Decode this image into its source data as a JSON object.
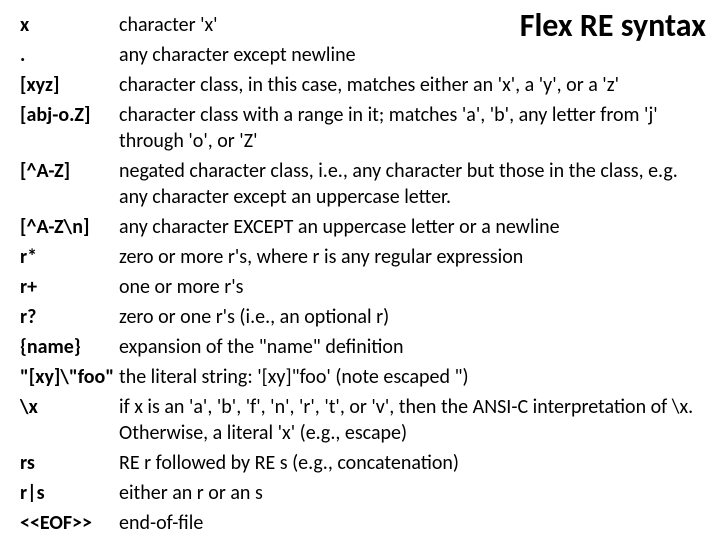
{
  "title": "Flex RE syntax",
  "rows": [
    {
      "pattern": "x",
      "desc": "character 'x'"
    },
    {
      "pattern": ".",
      "desc": "any character except newline"
    },
    {
      "pattern": "[xyz]",
      "desc": "character class, in this case, matches either an 'x', a 'y', or a 'z'"
    },
    {
      "pattern": "[abj-o.Z]",
      "desc": "character class with a range in it; matches 'a', 'b', any letter from 'j' through 'o', or 'Z'"
    },
    {
      "pattern": "[^A-Z]",
      "desc": "negated character class, i.e., any character but those in the class, e.g. any character except an uppercase letter."
    },
    {
      "pattern": "[^A-Z\\n]",
      "desc": "any character EXCEPT an uppercase letter or a newline"
    },
    {
      "pattern": "r*",
      "desc": "zero or more r's, where r is any regular expression"
    },
    {
      "pattern": "r+",
      "desc": "one or more r's"
    },
    {
      "pattern": "r?",
      "desc": "zero or one r's (i.e., an optional r)"
    },
    {
      "pattern": "{name}",
      "desc": "expansion of the \"name\" definition"
    },
    {
      "pattern": "\"[xy]\\\"foo\"",
      "desc": "the literal string: '[xy]\"foo' (note escaped \")"
    },
    {
      "pattern": "\\x",
      "desc": "if x is an 'a', 'b', 'f', 'n', 'r', 't', or 'v',  then the ANSI-C interpretation of \\x.  Otherwise, a literal 'x' (e.g., escape)"
    },
    {
      "pattern": "rs",
      "desc": "RE r followed by RE s (e.g., concatenation)"
    },
    {
      "pattern": "r|s",
      "desc": "either an r or an s"
    },
    {
      "pattern": "<<EOF>>",
      "desc": "end-of-file"
    }
  ]
}
